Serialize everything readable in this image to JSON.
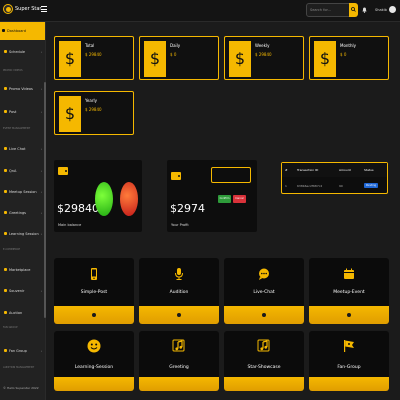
{
  "header": {
    "app_title": "Super Star",
    "search_placeholder": "Search for...",
    "user_name": "Shakib"
  },
  "sidebar": {
    "items": [
      {
        "label": "Dashboard",
        "active": true
      },
      {
        "label": "Schedule",
        "chevron": true
      },
      {
        "label": "Promo Videos",
        "chevron": true
      },
      {
        "label": "Post",
        "chevron": true
      },
      {
        "label": "Live Chat",
        "chevron": true
      },
      {
        "label": "QnA",
        "chevron": true
      },
      {
        "label": "Meetup Session",
        "chevron": true
      },
      {
        "label": "Greetings",
        "chevron": true
      },
      {
        "label": "Learning Session",
        "chevron": true
      },
      {
        "label": "Marketplace",
        "chevron": false
      },
      {
        "label": "Souvenir",
        "chevron": true
      },
      {
        "label": "Auction",
        "chevron": false
      },
      {
        "label": "Fan Group",
        "chevron": true
      }
    ],
    "sections": [
      "PROMO VIDEOS",
      "EVENT MANAGEMENT",
      "E-COMMERCE",
      "FAN GROUP",
      "AUDITION MANAGEMENT"
    ],
    "footer": "© Hello Superstar 2022"
  },
  "stats": [
    {
      "label": "Total",
      "value": "$ 29840"
    },
    {
      "label": "Daily",
      "value": "$ 0"
    },
    {
      "label": "Weekly",
      "value": "$ 29840"
    },
    {
      "label": "Monthly",
      "value": "$ 0"
    },
    {
      "label": "Yearly",
      "value": "$ 29840"
    }
  ],
  "main_balance": {
    "amount": "$29840",
    "caption": "Main balance"
  },
  "profit": {
    "amount": "$2974",
    "caption": "Your Profit",
    "confirm": "Confirm",
    "cancel": "Cancel"
  },
  "transactions": {
    "columns": [
      "#",
      "Transaction ID",
      "Amount",
      "Status"
    ],
    "rows": [
      {
        "index": "1",
        "id": "638b6ec2f687c2",
        "amount": "90",
        "status": "Pending"
      }
    ]
  },
  "categories": [
    {
      "label": "Simple-Post",
      "icon": "phone-icon"
    },
    {
      "label": "Audition",
      "icon": "microphone-icon"
    },
    {
      "label": "Live-Chat",
      "icon": "chat-bubble-icon"
    },
    {
      "label": "Meetup-Event",
      "icon": "calendar-icon"
    },
    {
      "label": "Learning-Session",
      "icon": "smile-icon"
    },
    {
      "label": "Greeting",
      "icon": "music-note-icon"
    },
    {
      "label": "Star-Showcase",
      "icon": "music-note-icon"
    },
    {
      "label": "Fan-Group",
      "icon": "flag-icon"
    }
  ],
  "colors": {
    "accent": "#f5b800",
    "background": "#1b1b1b",
    "pending": "#1f67d6",
    "confirm": "#2e9b3a",
    "cancel": "#d9323a"
  }
}
